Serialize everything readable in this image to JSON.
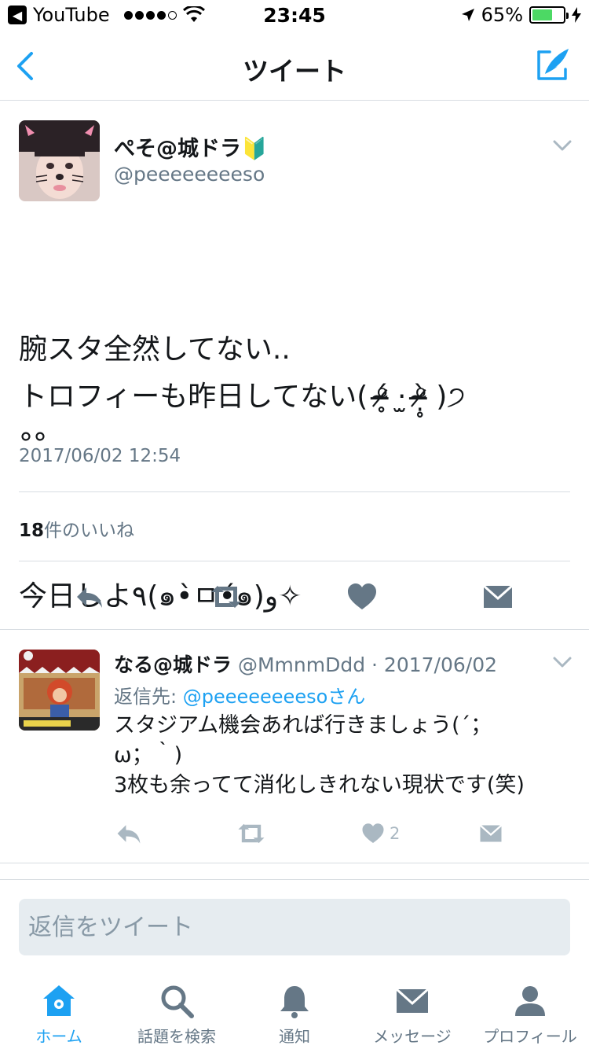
{
  "status_bar": {
    "back_app": "YouTube",
    "time": "23:45",
    "battery": "65%",
    "battery_level": 0.65
  },
  "nav": {
    "title": "ツイート",
    "back_icon": "chevron-left-icon",
    "compose_icon": "compose-tweet-icon"
  },
  "tweet": {
    "author_name": "ぺそ@城ドラ🔰",
    "author_handle": "@peeeeeeeeso",
    "text_lines": [
      "腕スタ全然してない..\nトロフィーも昨日してない( ᵒ̴̶̷̥́ ·̫ ᵒ̴̶̷̣̥̀ )੭\n°°",
      "今日しよ٩(๑•̀ㅁ•́๑)و✧"
    ],
    "timestamp": "2017/06/02 12:54",
    "likes_count": "18",
    "likes_label": "件のいいね"
  },
  "reply": {
    "name": "なる@城ドラ",
    "handle": "@MmnmDdd",
    "date": "2017/06/02",
    "meta": "@MmnmDdd · 2017/06/02",
    "reply_to_label": "返信先: ",
    "reply_to_handle": "@peeeeeeeesoさん",
    "text": "スタジアム機会あれば行きましょう(´；\nω；｀)\n3枚も余ってて消化しきれない現状です(笑)",
    "like_count": "2"
  },
  "reply_box": {
    "placeholder": "返信をツイート"
  },
  "tabs": [
    {
      "label": "ホーム",
      "icon": "home-icon",
      "active": true
    },
    {
      "label": "話題を検索",
      "icon": "search-icon",
      "active": false
    },
    {
      "label": "通知",
      "icon": "bell-icon",
      "active": false
    },
    {
      "label": "メッセージ",
      "icon": "envelope-icon",
      "active": false
    },
    {
      "label": "プロフィール",
      "icon": "person-icon",
      "active": false
    }
  ],
  "colors": {
    "accent": "#1da1f2",
    "muted": "#657786",
    "divider": "#d8dde2"
  }
}
